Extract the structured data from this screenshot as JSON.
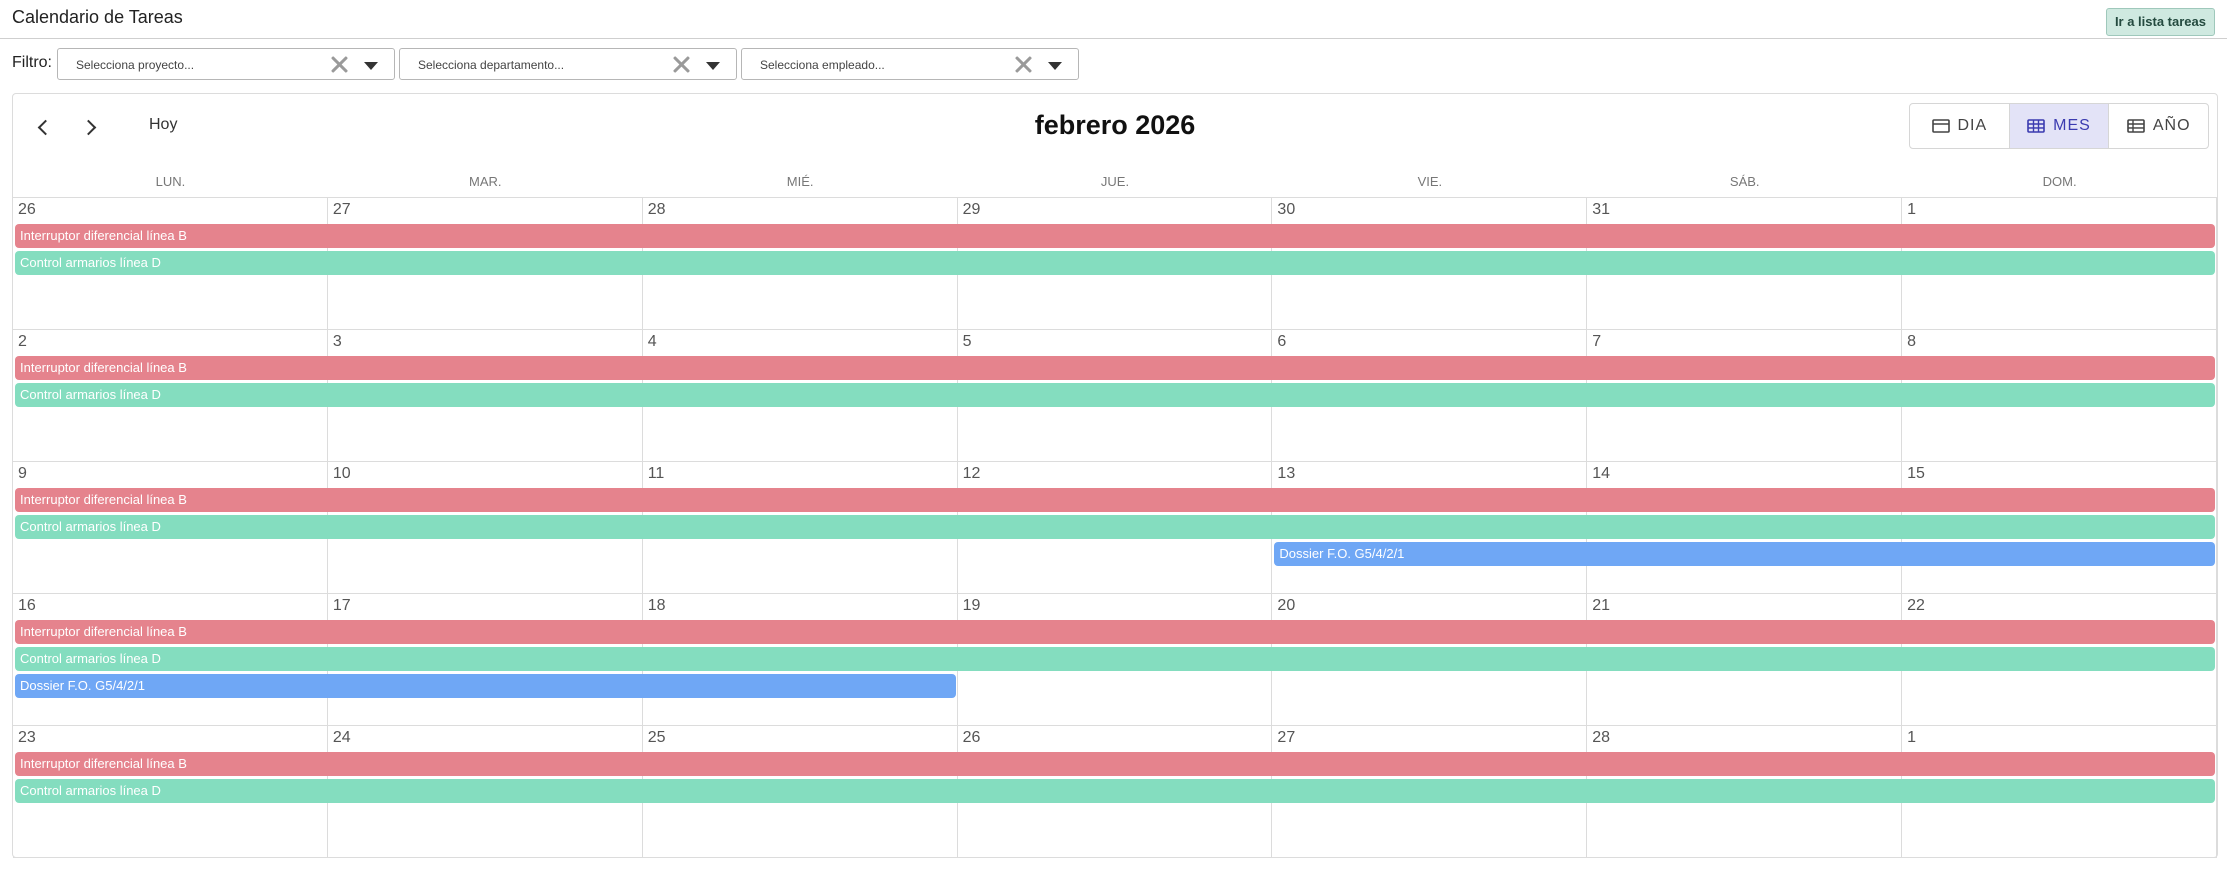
{
  "header": {
    "title": "Calendario de Tareas",
    "goto_label": "Ir a lista tareas"
  },
  "filter": {
    "label": "Filtro:",
    "project_placeholder": "Selecciona proyecto...",
    "department_placeholder": "Selecciona departamento...",
    "employee_placeholder": "Selecciona empleado..."
  },
  "calendar": {
    "title": "febrero 2026",
    "today_label": "Hoy",
    "views": [
      {
        "label": "DIA",
        "icon": "day-view-icon",
        "active": false
      },
      {
        "label": "MES",
        "icon": "month-view-icon",
        "active": true
      },
      {
        "label": "AÑO",
        "icon": "year-view-icon",
        "active": false
      }
    ],
    "weekdays": [
      "LUN.",
      "MAR.",
      "MIÉ.",
      "JUE.",
      "VIE.",
      "SÁB.",
      "DOM."
    ],
    "weeks": [
      {
        "days": [
          "26",
          "27",
          "28",
          "29",
          "30",
          "31",
          "1"
        ],
        "events": [
          {
            "title": "Interruptor diferencial línea B",
            "start": 0,
            "end": 6,
            "color": "red"
          },
          {
            "title": "Control armarios línea D",
            "start": 0,
            "end": 6,
            "color": "green"
          }
        ]
      },
      {
        "days": [
          "2",
          "3",
          "4",
          "5",
          "6",
          "7",
          "8"
        ],
        "events": [
          {
            "title": "Interruptor diferencial línea B",
            "start": 0,
            "end": 6,
            "color": "red"
          },
          {
            "title": "Control armarios línea D",
            "start": 0,
            "end": 6,
            "color": "green"
          }
        ]
      },
      {
        "days": [
          "9",
          "10",
          "11",
          "12",
          "13",
          "14",
          "15"
        ],
        "events": [
          {
            "title": "Interruptor diferencial línea B",
            "start": 0,
            "end": 6,
            "color": "red"
          },
          {
            "title": "Control armarios línea D",
            "start": 0,
            "end": 6,
            "color": "green"
          },
          {
            "title": "Dossier F.O. G5/4/2/1",
            "start": 4,
            "end": 6,
            "color": "blue"
          }
        ]
      },
      {
        "days": [
          "16",
          "17",
          "18",
          "19",
          "20",
          "21",
          "22"
        ],
        "events": [
          {
            "title": "Interruptor diferencial línea B",
            "start": 0,
            "end": 6,
            "color": "red"
          },
          {
            "title": "Control armarios línea D",
            "start": 0,
            "end": 6,
            "color": "green"
          },
          {
            "title": "Dossier F.O. G5/4/2/1",
            "start": 0,
            "end": 2,
            "color": "blue"
          }
        ]
      },
      {
        "days": [
          "23",
          "24",
          "25",
          "26",
          "27",
          "28",
          "1"
        ],
        "events": [
          {
            "title": "Interruptor diferencial línea B",
            "start": 0,
            "end": 6,
            "color": "red"
          },
          {
            "title": "Control armarios línea D",
            "start": 0,
            "end": 6,
            "color": "green"
          }
        ]
      }
    ]
  },
  "colors": {
    "red": "#e5838d",
    "green": "#84ddbf",
    "blue": "#6fa7f5",
    "accent": "#3b3bb0"
  }
}
